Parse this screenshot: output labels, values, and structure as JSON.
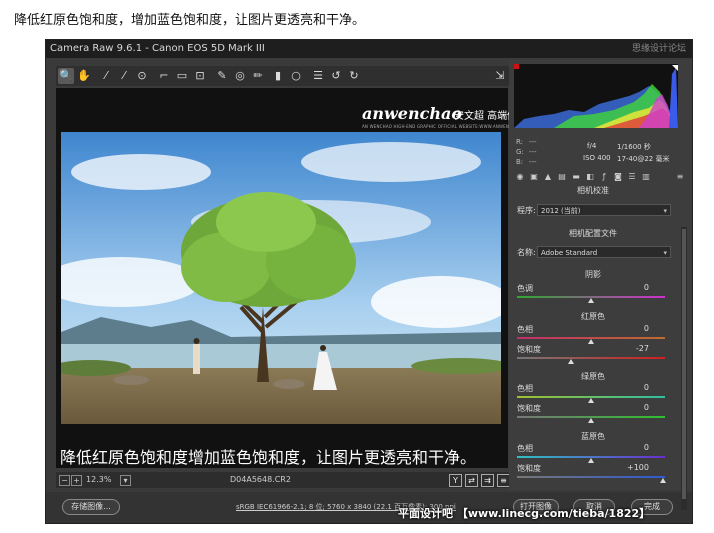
{
  "caption_top": "降低红原色饱和度，增加蓝色饱和度，让图片更透亮和干净。",
  "window": {
    "title": "Camera Raw 9.6.1 -  Canon EOS 5D Mark III",
    "title_watermark": "思缘设计论坛"
  },
  "toolbar": {
    "icons": [
      "zoom-icon",
      "hand-icon",
      "white-balance-icon",
      "color-sampler-icon",
      "target-adjust-icon",
      "crop-icon",
      "straighten-icon",
      "transform-icon",
      "spot-removal-icon",
      "red-eye-icon",
      "brush-icon",
      "graduated-filter-icon",
      "radial-filter-icon",
      "list-icon",
      "rotate-left-icon",
      "rotate-right-icon"
    ],
    "glyphs": [
      "🔍",
      "✋",
      "⁄",
      "⁄",
      "⊙",
      "⌐",
      "▭",
      "⊡",
      "✎",
      "◎",
      "✏",
      "▮",
      "○",
      "☰",
      "↺",
      "↻"
    ],
    "export_glyph": "⇲"
  },
  "preview": {
    "logo_text": "anwenchao",
    "logo_cn": "安文超 高端修图",
    "logo_sub": "AN WENCHAO HIGH-END GRAPHIC OFFICIAL WEBSITE:WWW.ANWENCHAO.COM",
    "overlay_caption": "降低红原色饱和度增加蓝色饱和度，让图片更透亮和干净。"
  },
  "status": {
    "zoom": "12.3%",
    "filename": "D04A5648.CR2",
    "y_label": "Y"
  },
  "bottom": {
    "save_label": "存储图像...",
    "workflow": "sRGB IEC61966-2.1; 8 位; 5760 x 3840 (22.1 百万像素); 300 ppi",
    "open_label": "打开图像",
    "cancel_label": "取消",
    "done_label": "完成",
    "site_watermark": "平面设计吧 【www.linecg.com/tieba/1822】"
  },
  "histogram": {
    "r_label": "R:",
    "g_label": "G:",
    "b_label": "B:",
    "r_val": "---",
    "g_val": "---",
    "b_val": "---",
    "aperture": "f/4",
    "shutter": "1/1600 秒",
    "iso": "ISO 400",
    "lens": "17-40@22 毫米"
  },
  "panel": {
    "title": "相机校准",
    "process_label": "程序:",
    "process_value": "2012 (当前)",
    "profile_head": "相机配置文件",
    "name_label": "名称:",
    "name_value": "Adobe Standard",
    "shadows_head": "阴影",
    "tint_label": "色调",
    "tint_value": "0",
    "red_head": "红原色",
    "red_hue_label": "色相",
    "red_hue_value": "0",
    "red_sat_label": "饱和度",
    "red_sat_value": "-27",
    "green_head": "绿原色",
    "green_hue_label": "色相",
    "green_hue_value": "0",
    "green_sat_label": "饱和度",
    "green_sat_value": "0",
    "blue_head": "蓝原色",
    "blue_hue_label": "色相",
    "blue_hue_value": "0",
    "blue_sat_label": "饱和度",
    "blue_sat_value": "+100"
  }
}
